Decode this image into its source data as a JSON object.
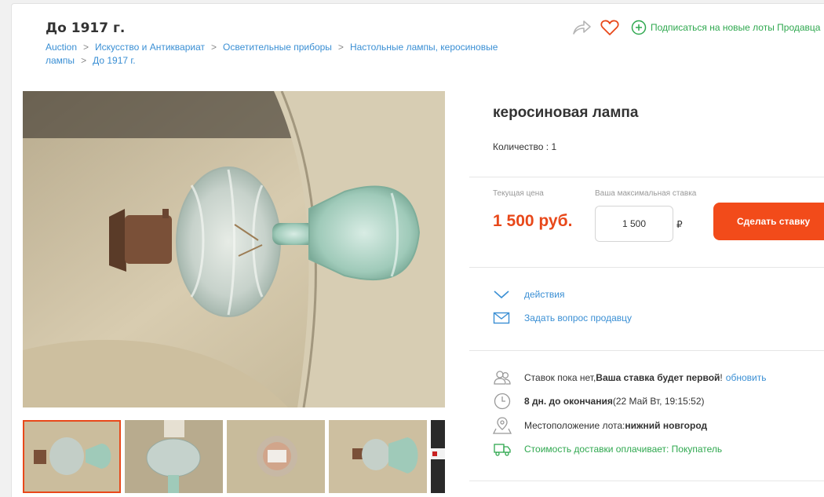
{
  "header": {
    "title": "До 1917 г.",
    "breadcrumb": [
      "Auction",
      "Искусство и Антиквариат",
      "Осветительные приборы",
      "Настольные лампы, керосиновые лампы",
      "До 1917 г."
    ],
    "subscribe_label": "Подписаться на новые лоты Продавца"
  },
  "lot": {
    "title": "керосиновая лампа",
    "quantity_text": "Количество : 1"
  },
  "bid": {
    "current_price_label": "Текущая цена",
    "current_price": "1 500 руб.",
    "max_bid_label": "Ваша максимальная ставка",
    "max_bid_value": "1 500",
    "currency_symbol": "₽",
    "button_label": "Сделать ставку"
  },
  "actions": {
    "actions_label": "действия",
    "ask_seller_label": "Задать вопрос продавцу"
  },
  "info": {
    "bids_prefix": "Ставок пока нет, ",
    "bids_bold": "Ваша ставка будет первой",
    "bids_suffix": "!",
    "refresh_label": "обновить",
    "time_bold": "8 дн. до окончания",
    "time_rest": " (22 Май Вт, 19:15:52)",
    "location_label": "Местоположение лота: ",
    "location_value": "нижний новгород",
    "shipping_text": "Стоимость доставки оплачивает: Покупатель"
  },
  "colors": {
    "accent": "#e8481a",
    "link": "#3a8fd4",
    "green": "#2fa84f"
  }
}
